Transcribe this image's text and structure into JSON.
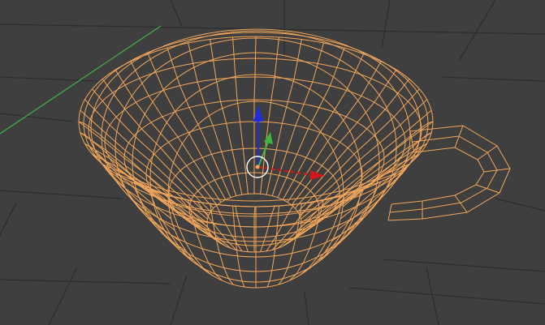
{
  "viewport": {
    "view": "3d-viewport",
    "object_display": "wireframe",
    "selected_object_color": "#f2a65a",
    "background_color": "#3f3f3f",
    "grid_color": "#303030",
    "x_axis_color": "#d01818",
    "y_axis_color": "#3fb540",
    "z_axis_color": "#1d2de0",
    "gizmo_ring_color": "#ffffff",
    "objects": [
      {
        "type": "cup",
        "selected": true,
        "shading": "wireframe"
      }
    ],
    "transform_gizmo": {
      "mode": "translate",
      "axes": [
        "x",
        "y",
        "z"
      ]
    }
  }
}
